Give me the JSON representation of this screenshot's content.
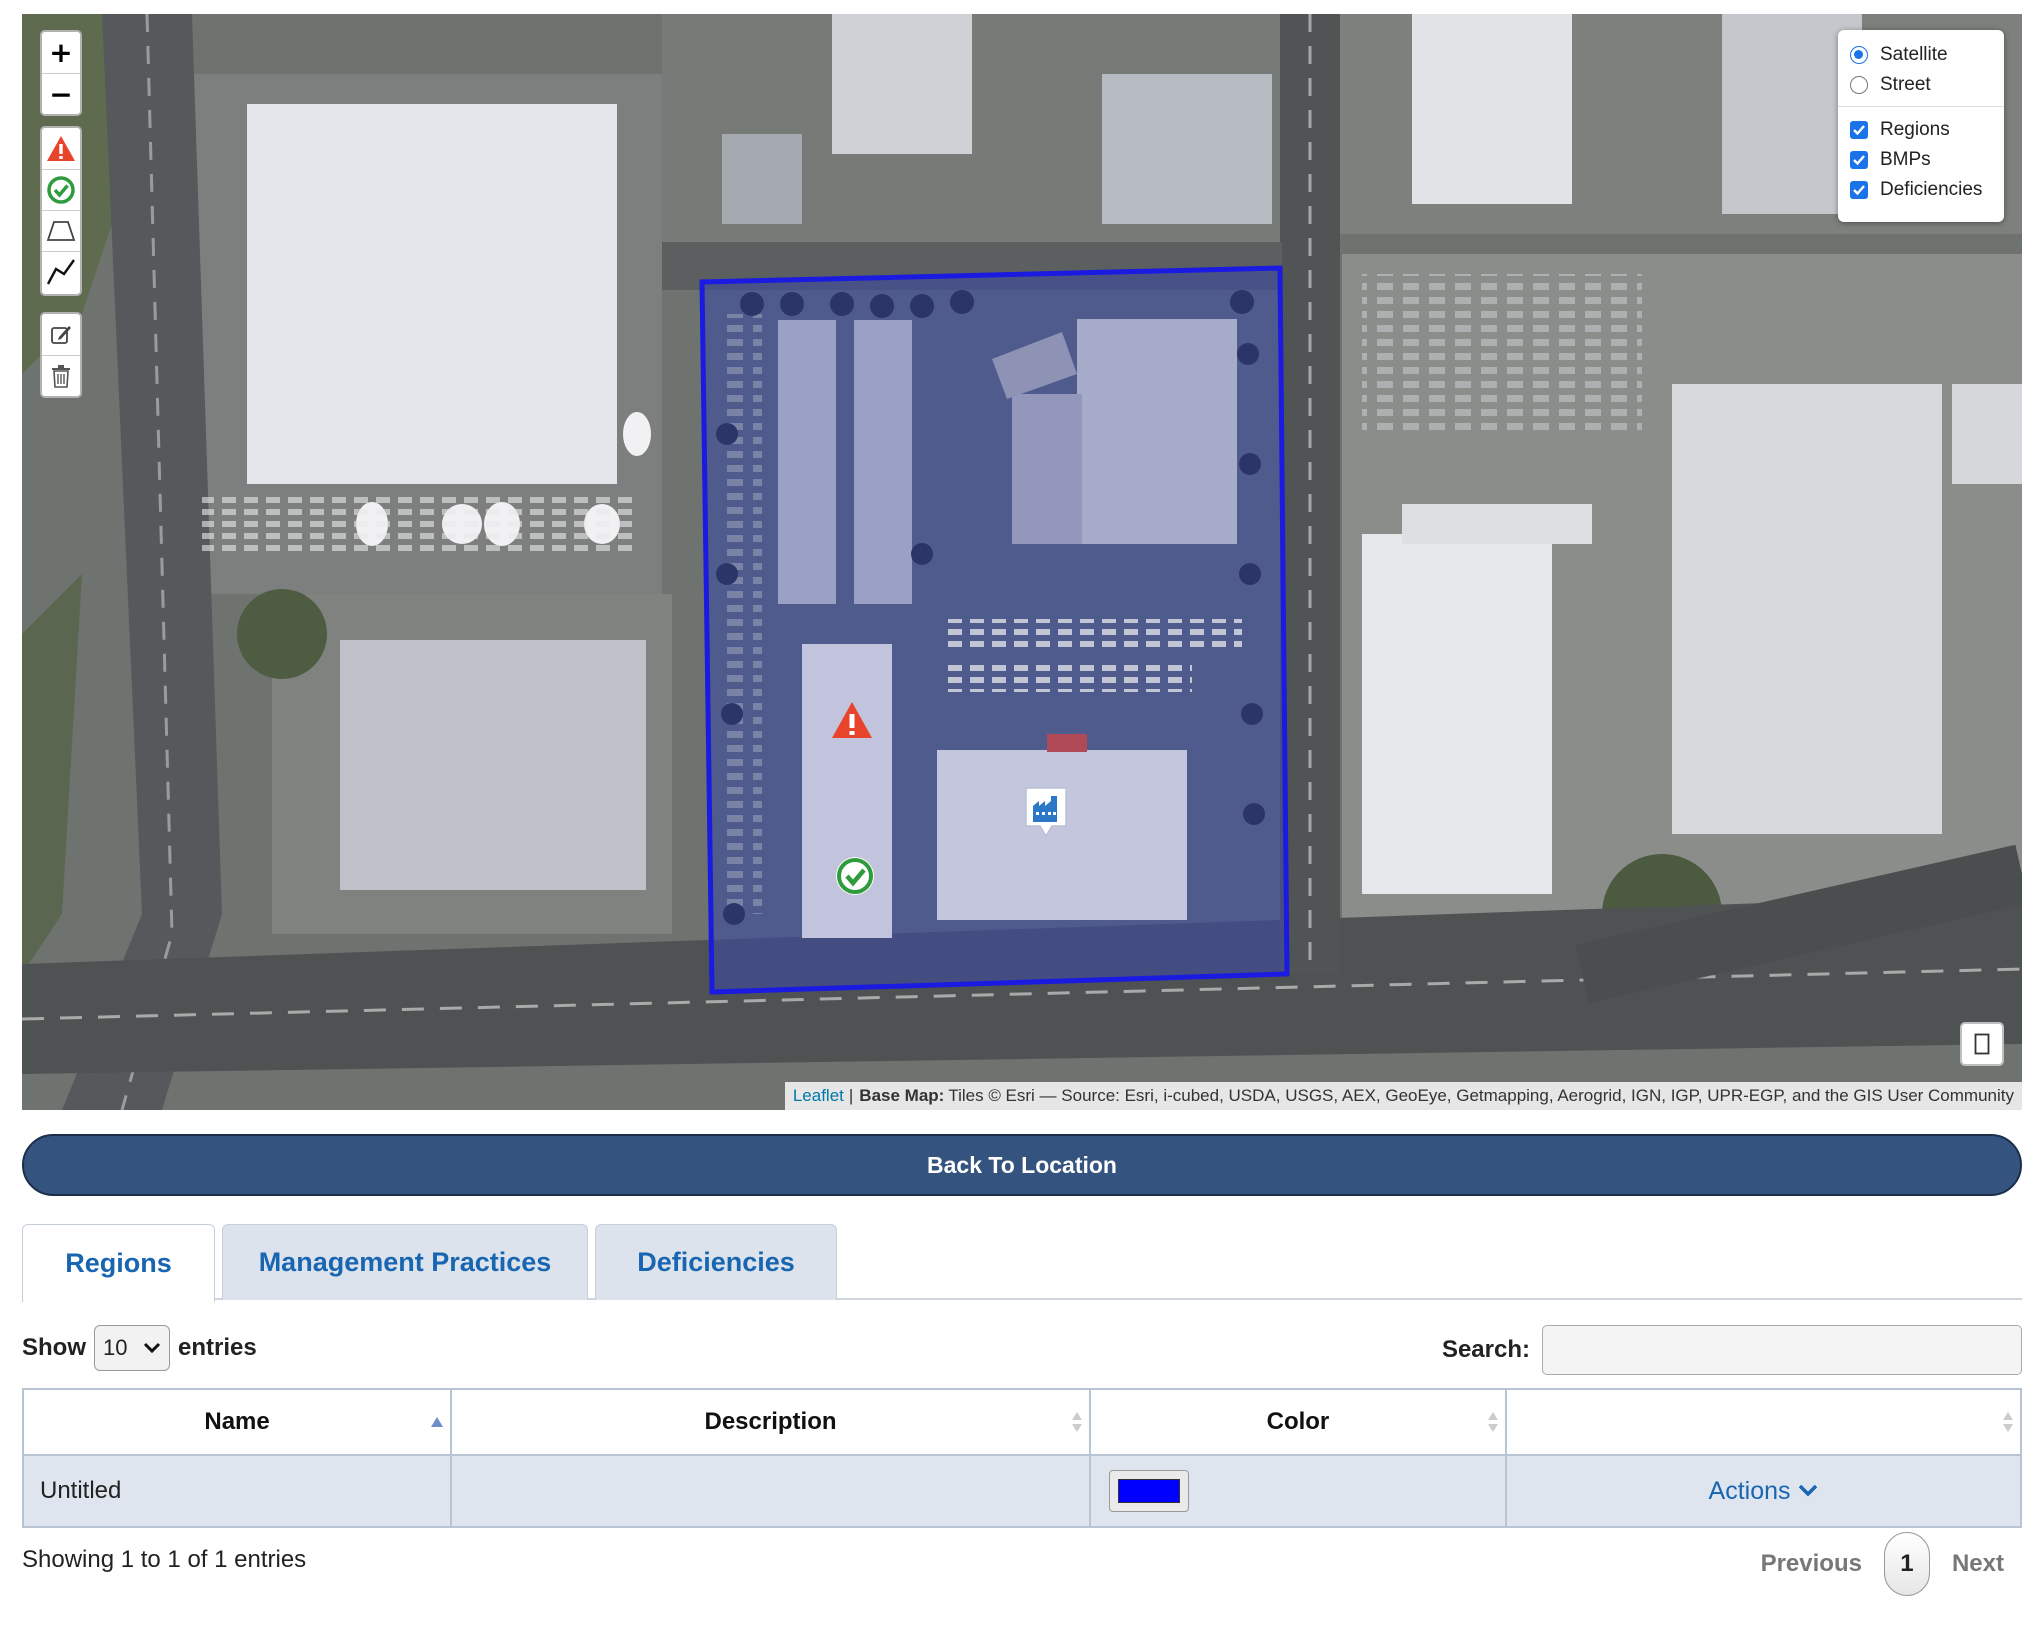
{
  "map": {
    "zoom_in": "+",
    "zoom_out": "−",
    "draw_tools": [
      "warning-marker-icon",
      "check-marker-icon",
      "polygon-icon",
      "polyline-icon"
    ],
    "edit_tools": [
      "edit-icon",
      "trash-icon"
    ],
    "layers": {
      "base": [
        {
          "label": "Satellite",
          "selected": true
        },
        {
          "label": "Street",
          "selected": false
        }
      ],
      "overlays": [
        {
          "label": "Regions",
          "checked": true
        },
        {
          "label": "BMPs",
          "checked": true
        },
        {
          "label": "Deficiencies",
          "checked": true
        }
      ]
    },
    "region_color": "#1a1ae0",
    "attribution": {
      "link": "Leaflet",
      "separator": "|",
      "label": "Base Map:",
      "text": "Tiles © Esri — Source: Esri, i-cubed, USDA, USGS, AEX, GeoEye, Getmapping, Aerogrid, IGN, IGP, UPR-EGP, and the GIS User Community"
    }
  },
  "back_button": "Back To Location",
  "tabs": [
    {
      "label": "Regions",
      "active": true
    },
    {
      "label": "Management Practices",
      "active": false
    },
    {
      "label": "Deficiencies",
      "active": false
    }
  ],
  "length": {
    "show": "Show",
    "value": "10",
    "entries": "entries"
  },
  "search": {
    "label": "Search:",
    "value": ""
  },
  "table": {
    "columns": [
      "Name",
      "Description",
      "Color",
      ""
    ],
    "rows": [
      {
        "name": "Untitled",
        "description": "",
        "color": "#0000ff",
        "actions": "Actions"
      }
    ]
  },
  "info": "Showing 1 to 1 of 1 entries",
  "pagination": {
    "previous": "Previous",
    "current": "1",
    "next": "Next"
  }
}
